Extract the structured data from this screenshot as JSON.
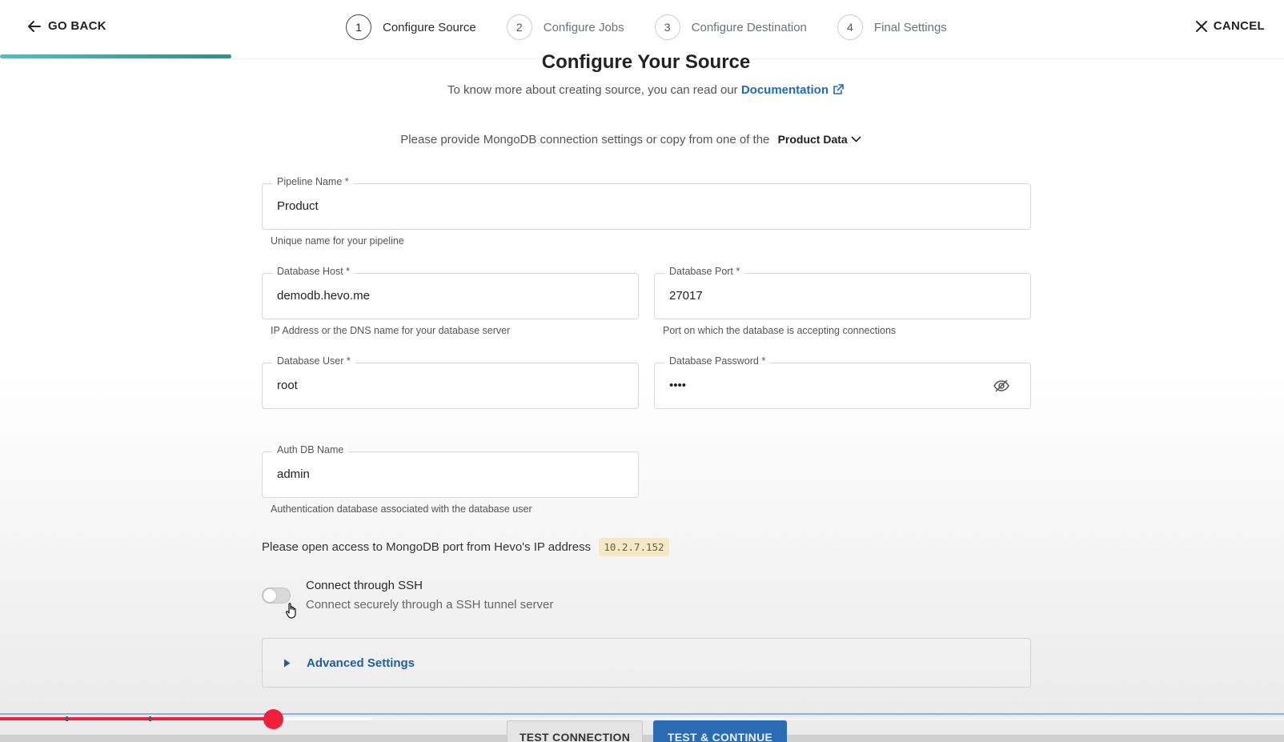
{
  "header": {
    "go_back": "GO BACK",
    "cancel": "CANCEL",
    "steps": [
      {
        "num": "1",
        "label": "Configure Source"
      },
      {
        "num": "2",
        "label": "Configure Jobs"
      },
      {
        "num": "3",
        "label": "Configure Destination"
      },
      {
        "num": "4",
        "label": "Final Settings"
      }
    ],
    "active_step": 1,
    "progress_fraction": 0.18
  },
  "main": {
    "title": "Configure Your Source",
    "subtitle_prefix": "To know more about creating source, you can read our",
    "doc_link": "Documentation",
    "copy_prefix": "Please provide MongoDB connection settings or copy from one of the",
    "copy_selected": "Product Data"
  },
  "fields": {
    "pipeline_name": {
      "label": "Pipeline Name *",
      "value": "Product",
      "hint": "Unique name for your pipeline"
    },
    "db_host": {
      "label": "Database Host *",
      "value": "demodb.hevo.me",
      "hint": "IP Address or the DNS name for your database server"
    },
    "db_port": {
      "label": "Database Port *",
      "value": "27017",
      "hint": "Port on which the database is accepting connections"
    },
    "db_user": {
      "label": "Database User *",
      "value": "root"
    },
    "db_password": {
      "label": "Database Password *",
      "value": "••••"
    },
    "auth_db": {
      "label": "Auth DB Name",
      "value": "admin",
      "hint": "Authentication database associated with the database user"
    }
  },
  "ip_access": {
    "text": "Please open access to MongoDB port from Hevo's IP address",
    "ip": "10.2.7.152"
  },
  "ssh": {
    "title": "Connect through SSH",
    "subtitle": "Connect securely through a SSH tunnel server",
    "enabled": false
  },
  "advanced": {
    "label": "Advanced Settings"
  },
  "actions": {
    "test_connection": "TEST CONNECTION",
    "test_continue": "TEST & CONTINUE"
  },
  "video": {
    "played_fraction": 0.21,
    "buffered_fraction": 0.29
  },
  "colors": {
    "accent": "#1f6cb3",
    "progress": "#3d8a83",
    "primary_button": "#2a6bb4",
    "video_red": "#f0203c"
  }
}
